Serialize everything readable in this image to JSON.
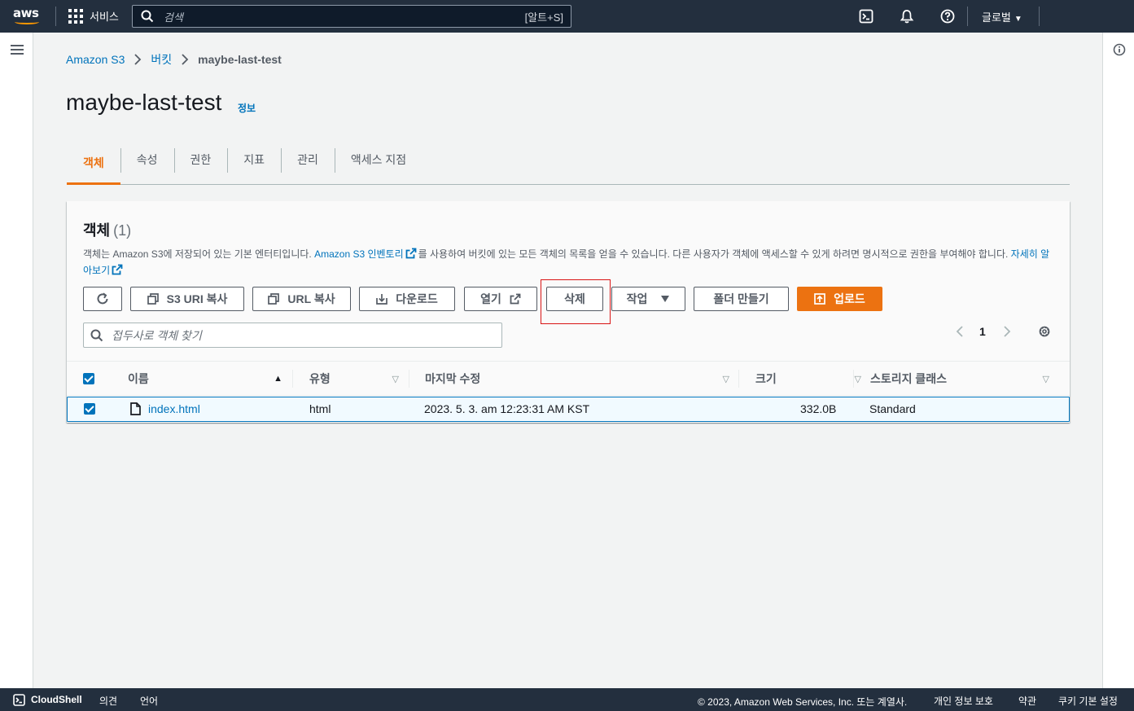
{
  "topnav": {
    "logo_text": "aws",
    "services_label": "서비스",
    "search_placeholder": "검색",
    "search_shortcut": "[알트+S]",
    "region_label": "글로벌"
  },
  "breadcrumb": {
    "items": [
      "Amazon S3",
      "버킷"
    ],
    "current": "maybe-last-test"
  },
  "page": {
    "title": "maybe-last-test",
    "info_link": "정보"
  },
  "tabs": [
    {
      "label": "객체",
      "active": true
    },
    {
      "label": "속성",
      "active": false
    },
    {
      "label": "권한",
      "active": false
    },
    {
      "label": "지표",
      "active": false
    },
    {
      "label": "관리",
      "active": false
    },
    {
      "label": "액세스 지점",
      "active": false
    }
  ],
  "panel": {
    "title": "객체",
    "count": "(1)",
    "desc_part1": "객체는 Amazon S3에 저장되어 있는 기본 엔터티입니다. ",
    "desc_link1": "Amazon S3 인벤토리",
    "desc_part2": "를 사용하여 버킷에 있는 모든 객체의 목록을 얻을 수 있습니다. 다른 사용자가 객체에 액세스할 수 있게 하려면 명시적으로 권한을 부여해야 합니다. ",
    "desc_link2": "자세히 알아보기"
  },
  "toolbar": {
    "s3_uri_copy": "S3 URI 복사",
    "url_copy": "URL 복사",
    "download": "다운로드",
    "open": "열기",
    "delete": "삭제",
    "actions": "작업",
    "create_folder": "폴더 만들기",
    "upload": "업로드"
  },
  "filter": {
    "placeholder": "접두사로 객체 찾기"
  },
  "pagination": {
    "current_page": "1"
  },
  "table": {
    "columns": [
      "이름",
      "유형",
      "마지막 수정",
      "크기",
      "스토리지 클래스"
    ],
    "rows": [
      {
        "name": "index.html",
        "type": "html",
        "last_modified": "2023. 5. 3. am 12:23:31 AM KST",
        "size": "332.0B",
        "storage_class": "Standard"
      }
    ]
  },
  "footer": {
    "cloudshell": "CloudShell",
    "feedback": "의견",
    "language": "언어",
    "copyright": "© 2023, Amazon Web Services, Inc. 또는 계열사.",
    "privacy": "개인 정보 보호",
    "terms": "약관",
    "cookie_prefs": "쿠키 기본 설정"
  },
  "colors": {
    "nav_bg": "#232f3e",
    "accent_orange": "#ec7211",
    "link_blue": "#0073bb",
    "highlight_red": "#d91515"
  }
}
